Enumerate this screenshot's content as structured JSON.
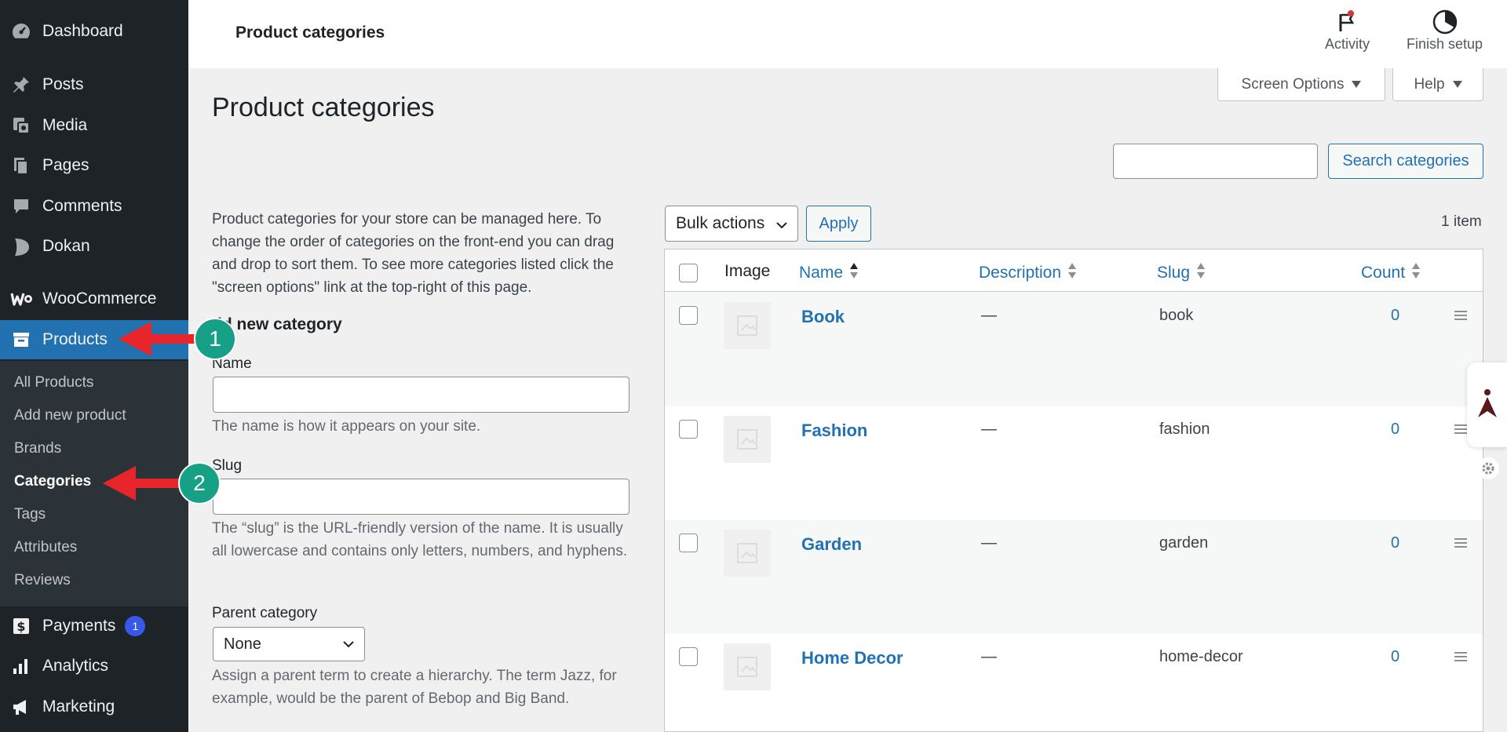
{
  "sidebar": {
    "items": [
      {
        "label": "Dashboard",
        "icon": "dashboard-icon"
      },
      {
        "label": "Posts",
        "icon": "pin-icon"
      },
      {
        "label": "Media",
        "icon": "media-icon"
      },
      {
        "label": "Pages",
        "icon": "pages-icon"
      },
      {
        "label": "Comments",
        "icon": "comment-icon"
      },
      {
        "label": "Dokan",
        "icon": "dokan-icon"
      },
      {
        "label": "WooCommerce",
        "icon": "woocommerce-icon"
      },
      {
        "label": "Products",
        "icon": "archive-icon"
      },
      {
        "label": "Payments",
        "icon": "dollar-icon",
        "badge": "1"
      },
      {
        "label": "Analytics",
        "icon": "bar-chart-icon"
      },
      {
        "label": "Marketing",
        "icon": "megaphone-icon"
      }
    ],
    "submenu": [
      "All Products",
      "Add new product",
      "Brands",
      "Categories",
      "Tags",
      "Attributes",
      "Reviews"
    ]
  },
  "topbar": {
    "title": "Product categories",
    "activity_label": "Activity",
    "finish_setup_label": "Finish setup"
  },
  "screen_options_label": "Screen Options",
  "help_label": "Help",
  "page_heading": "Product categories",
  "search": {
    "button_label": "Search categories",
    "value": ""
  },
  "intro_text": "Product categories for your store can be managed here. To change the order of categories on the front-end you can drag and drop to sort them. To see more categories listed click the \"screen options\" link at the top-right of this page.",
  "add_form": {
    "heading": "dd new category",
    "name_label": "Name",
    "name_help": "The name is how it appears on your site.",
    "slug_label": "Slug",
    "slug_help": "The “slug” is the URL-friendly version of the name. It is usually all lowercase and contains only letters, numbers, and hyphens.",
    "parent_label": "Parent category",
    "parent_value": "None",
    "parent_help": "Assign a parent term to create a hierarchy. The term Jazz, for example, would be the parent of Bebop and Big Band."
  },
  "table": {
    "bulk_actions_label": "Bulk actions",
    "apply_label": "Apply",
    "item_count": "1 item",
    "columns": {
      "image": "Image",
      "name": "Name",
      "description": "Description",
      "slug": "Slug",
      "count": "Count"
    },
    "rows": [
      {
        "name": "Book",
        "description": "—",
        "slug": "book",
        "count": "0"
      },
      {
        "name": "Fashion",
        "description": "—",
        "slug": "fashion",
        "count": "0"
      },
      {
        "name": "Garden",
        "description": "—",
        "slug": "garden",
        "count": "0"
      },
      {
        "name": "Home Decor",
        "description": "—",
        "slug": "home-decor",
        "count": "0"
      }
    ]
  },
  "annotations": {
    "step1": "1",
    "step2": "2"
  },
  "colors": {
    "sidebar_bg": "#1d2327",
    "active_menu": "#2271b1",
    "link": "#2271b1",
    "arrow": "#e8252a",
    "step_circle": "#16a085",
    "badge": "#3858e9"
  }
}
